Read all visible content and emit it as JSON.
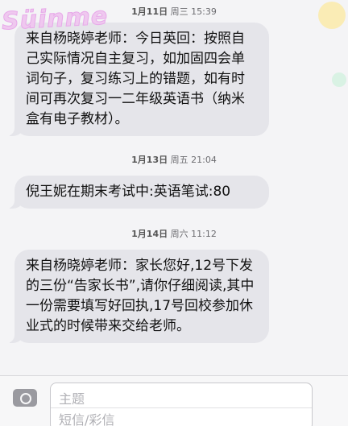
{
  "watermark": "Süinme",
  "messages": [
    {
      "stamp_date": "1月11日",
      "stamp_time": "周三 15:39",
      "text": "来自杨晓婷老师：今日英回：按照自己实际情况自主复习，如加固四会单词句子，复习练习上的错题，如有时间可再次复习一二年级英语书（纳米盒有电子教材）。"
    },
    {
      "stamp_date": "1月13日",
      "stamp_time": "周五 21:04",
      "text": "倪王妮在期末考试中:英语笔试:80"
    },
    {
      "stamp_date": "1月14日",
      "stamp_time": "周六 11:12",
      "text": "来自杨晓婷老师：家长您好,12号下发的三份“告家长书”,请你仔细阅读,其中一份需要填写好回执,17号回校参加休业式的时候带来交给老师。"
    }
  ],
  "composer": {
    "subject_placeholder": "主题",
    "message_placeholder": "短信/彩信"
  }
}
